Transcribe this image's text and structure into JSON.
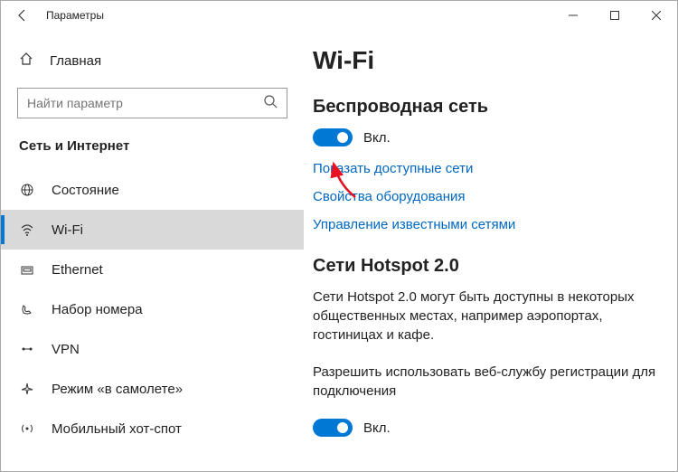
{
  "titlebar": {
    "title": "Параметры"
  },
  "sidebar": {
    "home_label": "Главная",
    "search_placeholder": "Найти параметр",
    "category": "Сеть и Интернет",
    "items": [
      {
        "label": "Состояние"
      },
      {
        "label": "Wi-Fi"
      },
      {
        "label": "Ethernet"
      },
      {
        "label": "Набор номера"
      },
      {
        "label": "VPN"
      },
      {
        "label": "Режим «в самолете»"
      },
      {
        "label": "Мобильный хот-спот"
      }
    ]
  },
  "content": {
    "page_title": "Wi-Fi",
    "wireless_header": "Беспроводная сеть",
    "toggle1_label": "Вкл.",
    "link_show_networks": "Показать доступные сети",
    "link_hw_props": "Свойства оборудования",
    "link_manage": "Управление известными сетями",
    "hotspot_header": "Сети Hotspot 2.0",
    "hotspot_desc": "Сети Hotspot 2.0 могут быть доступны в некоторых общественных местах, например аэропортах, гостиницах и кафе.",
    "hotspot_allow": "Разрешить использовать веб-службу регистрации для подключения",
    "toggle2_label": "Вкл."
  }
}
